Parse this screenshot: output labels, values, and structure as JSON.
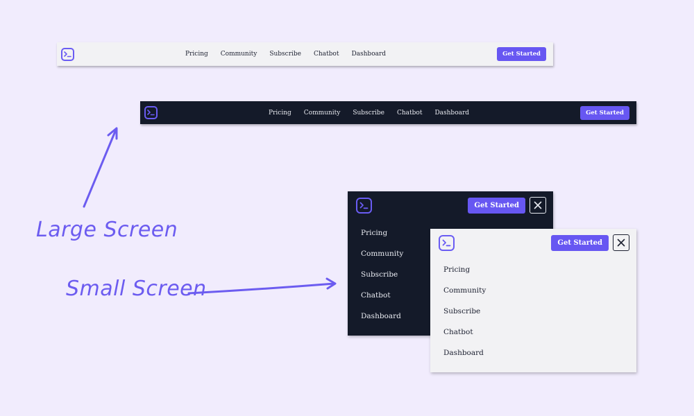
{
  "nav": {
    "links": [
      "Pricing",
      "Community",
      "Subscribe",
      "Chatbot",
      "Dashboard"
    ],
    "cta_label": "Get Started"
  },
  "annotations": {
    "large": "Large Screen",
    "small": "Small Screen"
  },
  "icons": {
    "logo": "terminal-prompt-icon",
    "close": "close-x-icon"
  },
  "colors": {
    "background": "#f1ecfd",
    "accent": "#6757f2",
    "dark_nav": "#141a29",
    "light_nav": "#f2f2f4"
  }
}
